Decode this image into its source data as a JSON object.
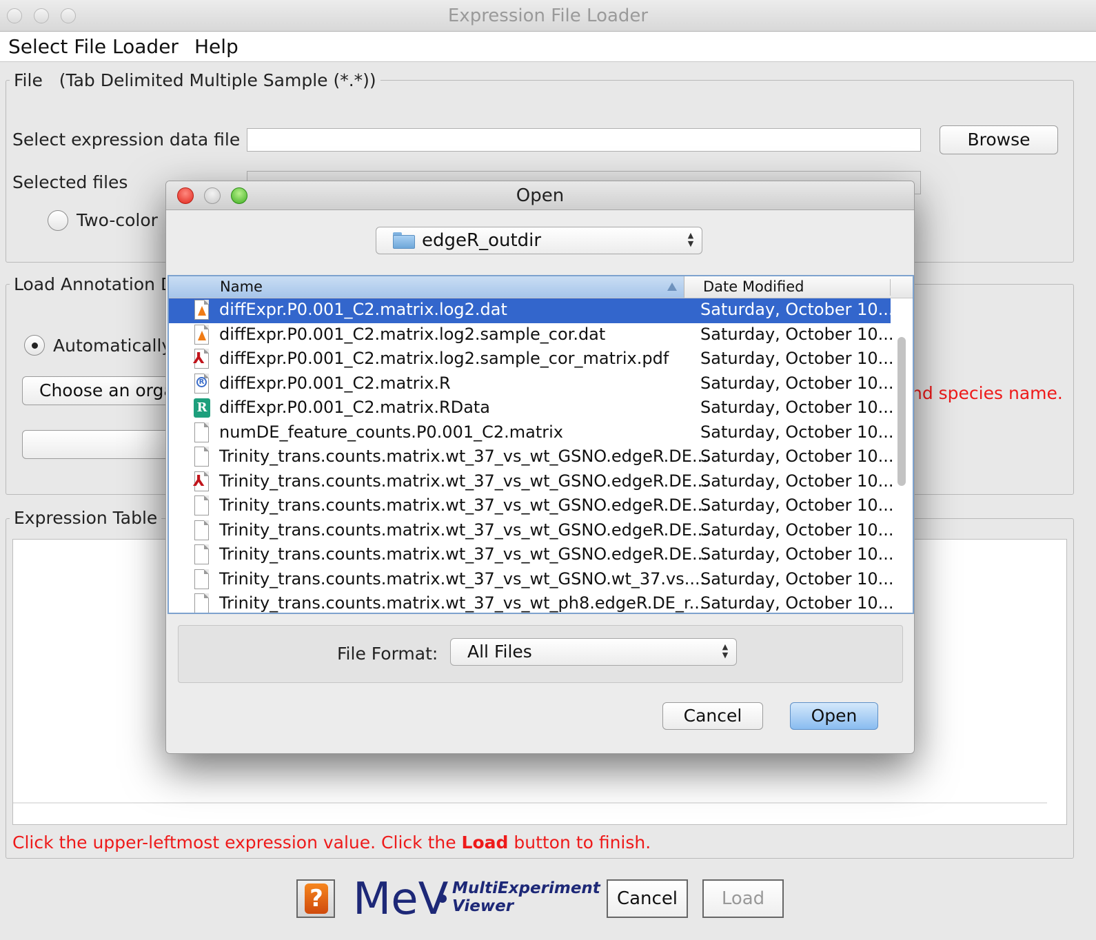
{
  "window": {
    "title": "Expression File Loader"
  },
  "menu": {
    "items": [
      "Select File Loader",
      "Help"
    ]
  },
  "file_panel": {
    "legend": "File",
    "subtitle": "(Tab Delimited Multiple Sample (*.*))",
    "select_label": "Select expression data file",
    "browse_label": "Browse",
    "selected_label": "Selected files",
    "two_color_label": "Two-color"
  },
  "annotation_panel": {
    "legend": "Load Annotation D",
    "auto_label": "Automatically",
    "choose_label": "Choose an orga",
    "warning_text": "nd species name."
  },
  "expression_panel": {
    "legend": "Expression Table",
    "instruction_pre": "Click the upper-leftmost expression value. Click the ",
    "instruction_bold": "Load",
    "instruction_post": " button to finish."
  },
  "footer": {
    "help_symbol": "?",
    "logo": "MeV",
    "logo_line1": "MultiExperiment",
    "logo_line2": "Viewer",
    "cancel_label": "Cancel",
    "load_label": "Load"
  },
  "open_dialog": {
    "title": "Open",
    "folder": "edgeR_outdir",
    "columns": {
      "name": "Name",
      "date": "Date Modified"
    },
    "files": [
      {
        "name": "diffExpr.P0.001_C2.matrix.log2.dat",
        "date": "Saturday, October 10...",
        "icon": "vlc-icon",
        "selected": true
      },
      {
        "name": "diffExpr.P0.001_C2.matrix.log2.sample_cor.dat",
        "date": "Saturday, October 10...",
        "icon": "vlc-icon"
      },
      {
        "name": "diffExpr.P0.001_C2.matrix.log2.sample_cor_matrix.pdf",
        "date": "Saturday, October 10...",
        "icon": "pdf-icon"
      },
      {
        "name": "diffExpr.P0.001_C2.matrix.R",
        "date": "Saturday, October 10...",
        "icon": "r-script-icon"
      },
      {
        "name": "diffExpr.P0.001_C2.matrix.RData",
        "date": "Saturday, October 10...",
        "icon": "rdata-icon"
      },
      {
        "name": "numDE_feature_counts.P0.001_C2.matrix",
        "date": "Saturday, October 10...",
        "icon": "document-icon"
      },
      {
        "name": "Trinity_trans.counts.matrix.wt_37_vs_wt_GSNO.edgeR.DE...",
        "date": "Saturday, October 10...",
        "icon": "document-icon"
      },
      {
        "name": "Trinity_trans.counts.matrix.wt_37_vs_wt_GSNO.edgeR.DE...",
        "date": "Saturday, October 10...",
        "icon": "pdf-icon"
      },
      {
        "name": "Trinity_trans.counts.matrix.wt_37_vs_wt_GSNO.edgeR.DE...",
        "date": "Saturday, October 10...",
        "icon": "document-icon"
      },
      {
        "name": "Trinity_trans.counts.matrix.wt_37_vs_wt_GSNO.edgeR.DE...",
        "date": "Saturday, October 10...",
        "icon": "document-icon"
      },
      {
        "name": "Trinity_trans.counts.matrix.wt_37_vs_wt_GSNO.edgeR.DE...",
        "date": "Saturday, October 10...",
        "icon": "document-icon"
      },
      {
        "name": "Trinity_trans.counts.matrix.wt_37_vs_wt_GSNO.wt_37.vs....",
        "date": "Saturday, October 10...",
        "icon": "document-icon"
      },
      {
        "name": "Trinity_trans.counts.matrix.wt_37_vs_wt_ph8.edgeR.DE_r...",
        "date": "Saturday, October 10...",
        "icon": "document-icon"
      }
    ],
    "format_label": "File Format:",
    "format_value": "All Files",
    "cancel_label": "Cancel",
    "open_label": "Open"
  },
  "colors": {
    "selection": "#3366cc",
    "warning": "#ee1a1a",
    "logo": "#1d2877"
  }
}
